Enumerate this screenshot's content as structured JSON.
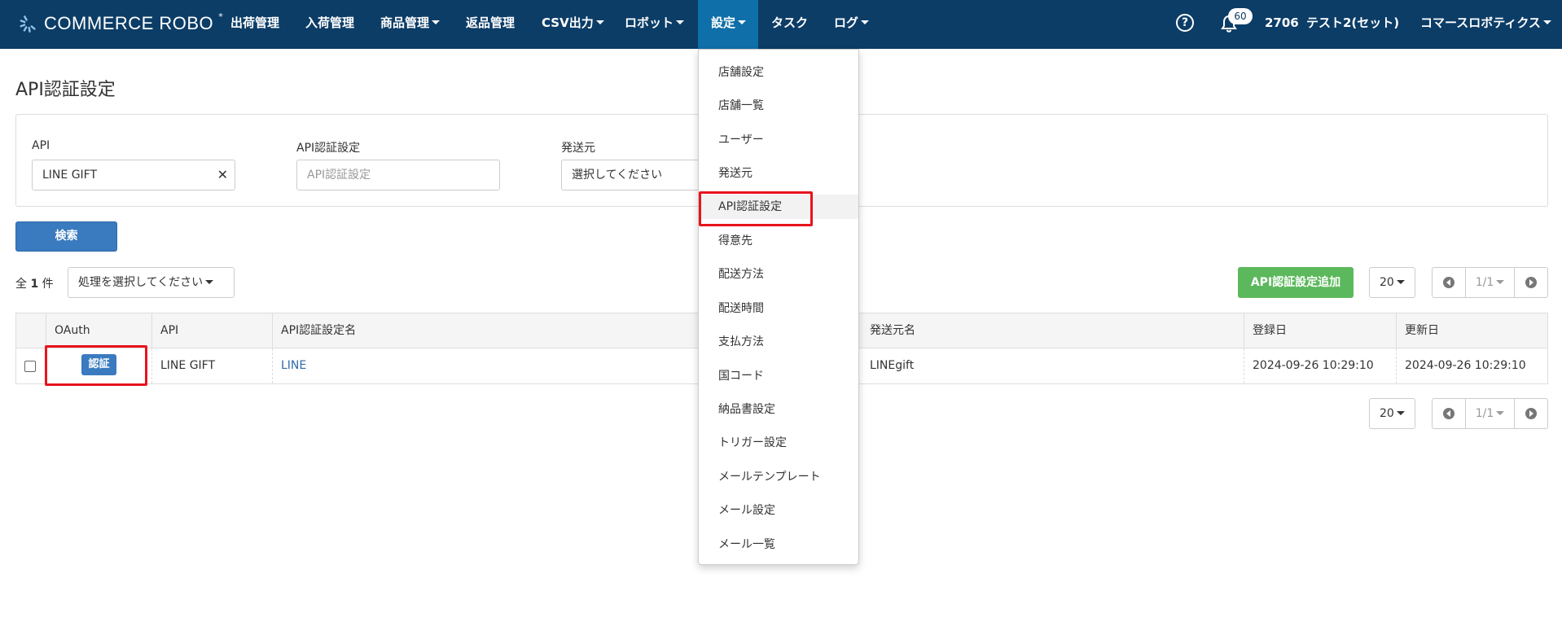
{
  "navbar": {
    "brand": "COMMERCE ROBO",
    "items": [
      {
        "label": "出荷管理",
        "caret": false
      },
      {
        "label": "入荷管理",
        "caret": false
      },
      {
        "label": "商品管理",
        "caret": true
      },
      {
        "label": "返品管理",
        "caret": false
      },
      {
        "label": "CSV出力",
        "caret": true
      },
      {
        "label": "ロボット",
        "caret": true
      },
      {
        "label": "設定",
        "caret": true,
        "active": true
      },
      {
        "label": "タスク",
        "caret": false
      },
      {
        "label": "ログ",
        "caret": true
      }
    ],
    "help_icon": "question-circle-icon",
    "bell_icon": "bell-icon",
    "notification_count": "60",
    "user_id": "2706",
    "user_name": "テスト2(セット)",
    "company": "コマースロボティクス"
  },
  "page": {
    "title": "API認証設定"
  },
  "filters": {
    "api_label": "API",
    "api_value": "LINE GIFT",
    "auth_label": "API認証設定",
    "auth_placeholder": "API認証設定",
    "sender_label": "発送元",
    "sender_value": "選択してください"
  },
  "search_button": "検索",
  "list": {
    "total_prefix": "全",
    "total_count": "1",
    "total_suffix": "件",
    "action_select": "処理を選択してください",
    "add_button": "API認証設定追加",
    "per_page": "20",
    "page_indicator": "1/1"
  },
  "table": {
    "headers": [
      "OAuth",
      "API",
      "API認証設定名",
      "発送元名",
      "登録日",
      "更新日"
    ],
    "rows": [
      {
        "oauth_button": "認証",
        "api": "LINE GIFT",
        "name": "LINE",
        "sender": "LINEgift",
        "created": "2024-09-26 10:29:10",
        "updated": "2024-09-26 10:29:10"
      }
    ]
  },
  "settings_menu": {
    "items": [
      "店舗設定",
      "店舗一覧",
      "ユーザー",
      "発送元",
      "API認証設定",
      "得意先",
      "配送方法",
      "配送時間",
      "支払方法",
      "国コード",
      "納品書設定",
      "トリガー設定",
      "メールテンプレート",
      "メール設定",
      "メール一覧"
    ],
    "highlighted": "API認証設定"
  },
  "colors": {
    "navbar": "#0c3d67",
    "active_nav": "#0f6fa8",
    "primary": "#3a7abf",
    "success": "#5cb85c",
    "highlight_box": "#e8141b"
  }
}
